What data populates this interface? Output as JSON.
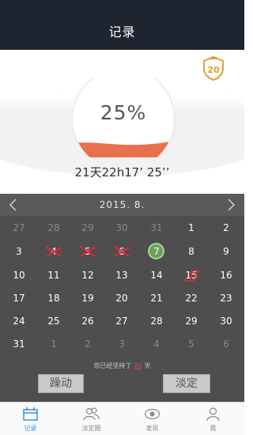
{
  "header": {
    "title": "记录"
  },
  "badge": {
    "value": "20",
    "color": "#e0a12b"
  },
  "progress": {
    "label": "25%",
    "fraction": 0.25,
    "fill_color": "#e8704d"
  },
  "elapsed": "21天22h17’ 25’’",
  "calendar": {
    "month_label": "2015. 8.",
    "prev_icon": "chevron-left-icon",
    "next_icon": "chevron-right-icon",
    "weeks": [
      [
        {
          "d": "27",
          "o": true
        },
        {
          "d": "28",
          "o": true
        },
        {
          "d": "29",
          "o": true
        },
        {
          "d": "30",
          "o": true
        },
        {
          "d": "31",
          "o": true
        },
        {
          "d": "1"
        },
        {
          "d": "2"
        }
      ],
      [
        {
          "d": "3"
        },
        {
          "d": "4",
          "m": "x"
        },
        {
          "d": "5",
          "m": "x"
        },
        {
          "d": "6",
          "m": "x"
        },
        {
          "d": "7",
          "m": "today"
        },
        {
          "d": "8"
        },
        {
          "d": "9"
        }
      ],
      [
        {
          "d": "10"
        },
        {
          "d": "11"
        },
        {
          "d": "12"
        },
        {
          "d": "13"
        },
        {
          "d": "14"
        },
        {
          "d": "15",
          "m": "scribble"
        },
        {
          "d": "16"
        }
      ],
      [
        {
          "d": "17"
        },
        {
          "d": "18"
        },
        {
          "d": "19"
        },
        {
          "d": "20"
        },
        {
          "d": "21"
        },
        {
          "d": "22"
        },
        {
          "d": "23"
        }
      ],
      [
        {
          "d": "24"
        },
        {
          "d": "25"
        },
        {
          "d": "26"
        },
        {
          "d": "27"
        },
        {
          "d": "28"
        },
        {
          "d": "29"
        },
        {
          "d": "30"
        }
      ],
      [
        {
          "d": "31"
        },
        {
          "d": "1",
          "o": true
        },
        {
          "d": "2",
          "o": true
        },
        {
          "d": "3",
          "o": true
        },
        {
          "d": "4",
          "o": true
        },
        {
          "d": "5",
          "o": true
        },
        {
          "d": "6",
          "o": true
        }
      ]
    ],
    "streak_prefix": "您已经坚持了",
    "streak_count": "20",
    "streak_suffix": "天",
    "restless_label": "躁动",
    "calm_label": "淡定"
  },
  "tabs": [
    {
      "label": "记录",
      "icon": "calendar-icon",
      "active": true
    },
    {
      "label": "淡定圈",
      "icon": "group-icon",
      "active": false
    },
    {
      "label": "发现",
      "icon": "eye-icon",
      "active": false
    },
    {
      "label": "我",
      "icon": "person-icon",
      "active": false
    }
  ]
}
